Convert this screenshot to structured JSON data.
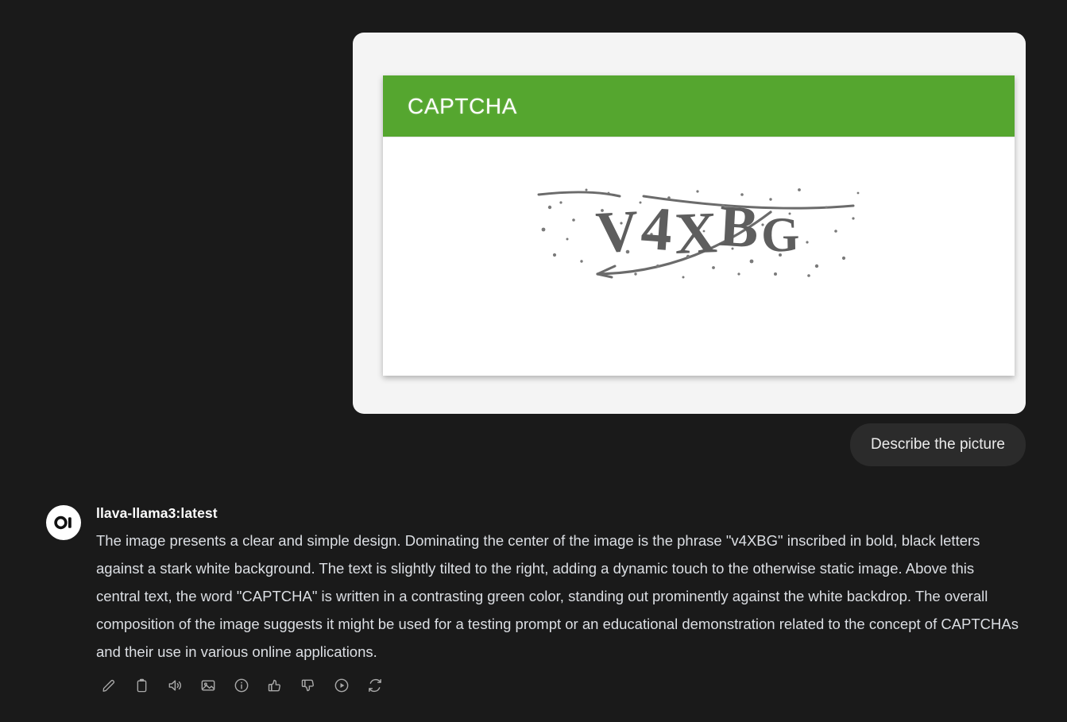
{
  "page": {
    "background_color": "#1a1a1a"
  },
  "attachment": {
    "card_background": "#f4f4f4",
    "captcha": {
      "header_title": "CAPTCHA",
      "header_color": "#55a62f",
      "panel_background": "#ffffff",
      "code": "V4XBG",
      "code_letters": [
        "V",
        "4",
        "X",
        "B",
        "G"
      ],
      "code_color": "#5e5e5e"
    }
  },
  "user_message": {
    "text": "Describe the picture",
    "bubble_color": "#2b2b2b"
  },
  "assistant_message": {
    "avatar_icon": "ollama-logo-icon",
    "model_name": "llava-llama3:latest",
    "text": "The image presents a clear and simple design. Dominating the center of the image is the phrase \"v4XBG\" inscribed in bold, black letters against a stark white background. The text is slightly tilted to the right, adding a dynamic touch to the otherwise static image. Above this central text, the word \"CAPTCHA\" is written in a contrasting green color, standing out prominently against the white backdrop. The overall composition of the image suggests it might be used for a testing prompt or an educational demonstration related to the concept of CAPTCHAs and their use in various online applications.",
    "actions": [
      {
        "name": "edit-icon",
        "label": "Edit"
      },
      {
        "name": "copy-icon",
        "label": "Copy"
      },
      {
        "name": "read-aloud-icon",
        "label": "Read Aloud"
      },
      {
        "name": "generate-image-icon",
        "label": "Generate Image"
      },
      {
        "name": "info-icon",
        "label": "Info"
      },
      {
        "name": "thumbs-up-icon",
        "label": "Good Response"
      },
      {
        "name": "thumbs-down-icon",
        "label": "Bad Response"
      },
      {
        "name": "continue-response-icon",
        "label": "Continue Response"
      },
      {
        "name": "regenerate-icon",
        "label": "Regenerate"
      }
    ]
  }
}
